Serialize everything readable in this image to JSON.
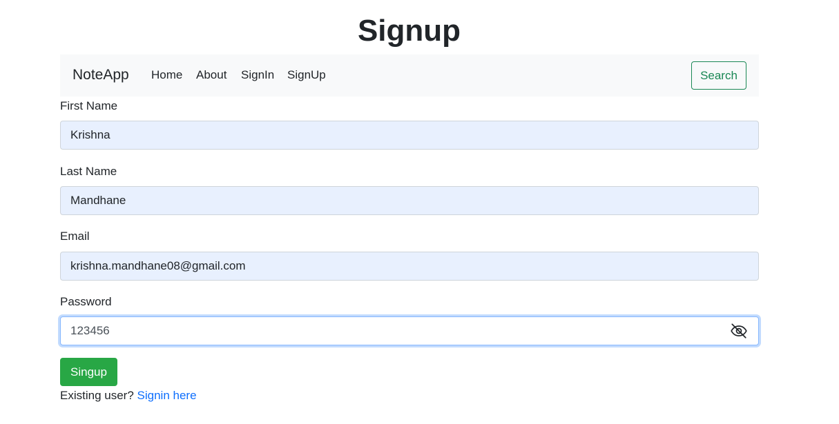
{
  "page": {
    "title": "Signup"
  },
  "navbar": {
    "brand": "NoteApp",
    "links": [
      "Home",
      "About",
      "SignIn",
      "SignUp"
    ],
    "search_label": "Search"
  },
  "form": {
    "first_name": {
      "label": "First Name",
      "value": "Krishna"
    },
    "last_name": {
      "label": "Last Name",
      "value": "Mandhane"
    },
    "email": {
      "label": "Email",
      "value": "krishna.mandhane08@gmail.com"
    },
    "password": {
      "label": "Password",
      "value": "123456",
      "toggle_icon": "eye-slash-icon"
    },
    "submit_label": "Singup"
  },
  "footer": {
    "prompt": "Existing user?",
    "link_text": "Signin here"
  },
  "colors": {
    "accent_green": "#28a745",
    "outline_green": "#198754",
    "link_blue": "#0d6efd",
    "autofill_bg": "#e8f0fe",
    "navbar_bg": "#f8f9fa"
  }
}
